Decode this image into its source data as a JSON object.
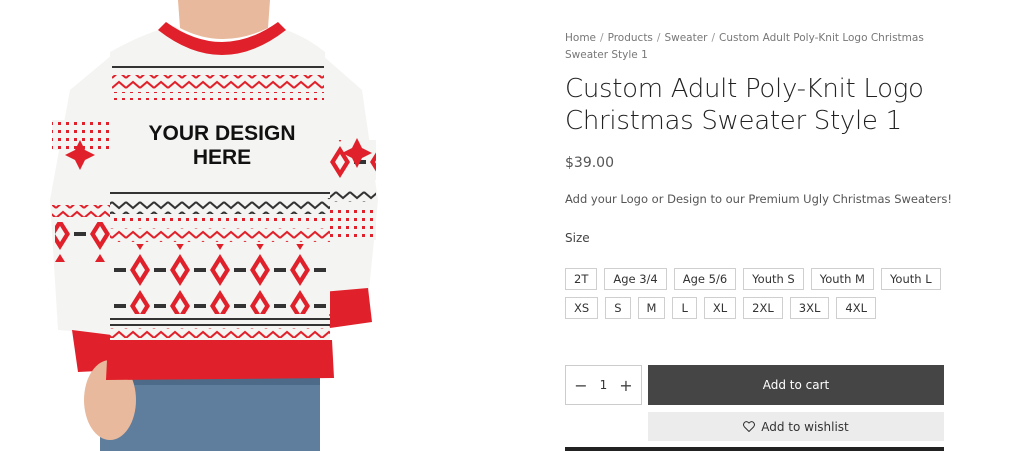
{
  "image": {
    "alt": "Custom Adult Poly-Knit Logo Christmas Sweater Style 1",
    "overlay_text_line1": "YOUR DESIGN",
    "overlay_text_line2": "HERE"
  },
  "breadcrumb": {
    "items": [
      "Home",
      "Products",
      "Sweater",
      "Custom Adult Poly-Knit Logo Christmas Sweater Style 1"
    ],
    "separator": "/"
  },
  "product": {
    "title": "Custom Adult Poly-Knit Logo Christmas Sweater Style 1",
    "price": "$39.00",
    "short_description": "Add your Logo or Design to our Premium Ugly Christmas Sweaters!"
  },
  "size": {
    "label": "Size",
    "options": [
      "2T",
      "Age 3/4",
      "Age 5/6",
      "Youth S",
      "Youth M",
      "Youth L",
      "XS",
      "S",
      "M",
      "L",
      "XL",
      "2XL",
      "3XL",
      "4XL"
    ]
  },
  "cart": {
    "quantity": "1",
    "minus_symbol": "−",
    "plus_symbol": "+",
    "add_to_cart_label": "Add to cart",
    "wishlist_label": "Add to wishlist"
  },
  "colors": {
    "sweater_red": "#e0202a",
    "sweater_white": "#f4f4f2",
    "button_dark": "#454545",
    "wishlist_bg": "#ececec"
  },
  "icons": {
    "wishlist": "heart-icon",
    "quantity_minus": "minus-icon",
    "quantity_plus": "plus-icon"
  }
}
